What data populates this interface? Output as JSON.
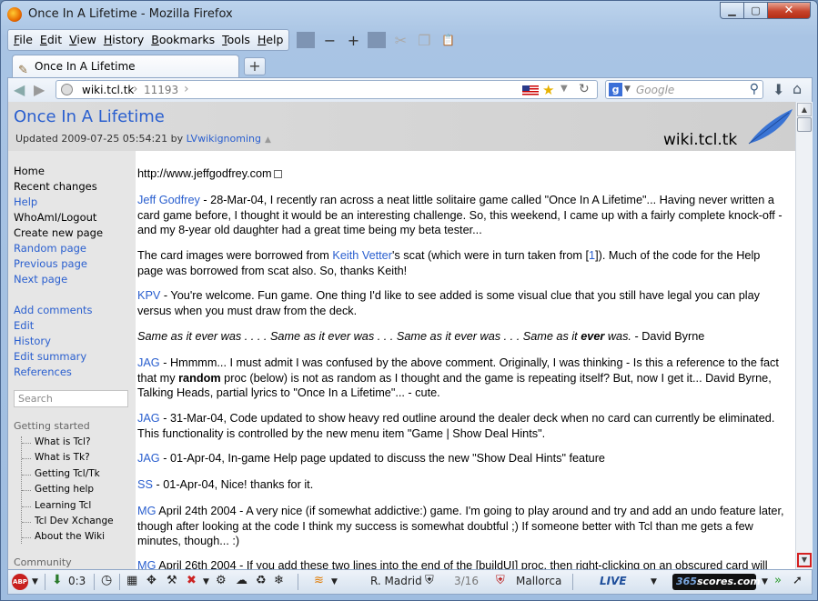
{
  "window": {
    "title": "Once In A Lifetime - Mozilla Firefox",
    "buttons": {
      "minimize": "▁",
      "maximize": "▢",
      "close": "✕"
    }
  },
  "menubar": {
    "items": [
      {
        "label": "File",
        "key": "F",
        "rest": "ile"
      },
      {
        "label": "Edit",
        "key": "E",
        "rest": "dit"
      },
      {
        "label": "View",
        "key": "V",
        "rest": "iew"
      },
      {
        "label": "History",
        "key": "H",
        "rest": "istory"
      },
      {
        "label": "Bookmarks",
        "key": "B",
        "rest": "ookmarks"
      },
      {
        "label": "Tools",
        "key": "T",
        "rest": "ools"
      },
      {
        "label": "Help",
        "key": "H",
        "rest": "elp"
      }
    ],
    "icons": {
      "zoom_out": "−",
      "zoom_in": "+",
      "cut": "✂",
      "copy": "❐",
      "paste": "📋"
    }
  },
  "tabs": {
    "active_tab": "Once In A Lifetime",
    "new_tab": "+"
  },
  "nav": {
    "url_domain": "wiki.tcl.tk",
    "url_path": "11193",
    "search_placeholder": "Google",
    "search_engine_letter": "g"
  },
  "page": {
    "title": "Once In A Lifetime",
    "updated_prefix": "Updated 2009-07-25 05:54:21 by ",
    "updated_author": "LVwikignoming",
    "site_name": "wiki.tcl.tk"
  },
  "sidebar": {
    "nav_links": [
      "Home",
      "Recent changes",
      "Help",
      "WhoAmI/Logout",
      "Create new page",
      "Random page",
      "Previous page",
      "Next page"
    ],
    "page_links": [
      "Add comments",
      "Edit",
      "History",
      "Edit summary",
      "References"
    ],
    "search_placeholder": "Search",
    "getting_started_heading": "Getting started",
    "getting_started_items": [
      "What is Tcl?",
      "What is Tk?",
      "Getting Tcl/Tk",
      "Getting help",
      "Learning Tcl",
      "Tcl Dev Xchange",
      "About the Wiki"
    ],
    "community_heading": "Community"
  },
  "content": {
    "p0_link": "http://www.jeffgodfrey.com",
    "p1_author": "Jeff Godfrey",
    "p1_text": " - 28-Mar-04, I recently ran across a neat little solitaire game called \"Once In A Lifetime\"... Having never written a card game before, I thought it would be an interesting challenge. So, this weekend, I came up with a fairly complete knock-off - and my 8-year old daughter had a great time being my beta tester...",
    "p2_a": "The card images were borrowed from ",
    "p2_link": "Keith Vetter",
    "p2_b": "'s scat (which were in turn taken from [",
    "p2_ref": "1",
    "p2_c": "]). Much of the code for the Help page was borrowed from scat also. So, thanks Keith!",
    "p3_author": "KPV",
    "p3_text": " - You're welcome. Fun game. One thing I'd like to see added is some visual clue that you still have legal you can play versus when you must draw from the deck.",
    "p4_italic": "Same as it ever was . . . . Same as it ever was . . . Same as it ever was . . . Same as it ",
    "p4_bold": "ever",
    "p4_italic2": " was.",
    "p4_tail": " - David Byrne",
    "p5_author": "JAG",
    "p5_a": " - Hmmmm... I must admit I was confused by the above comment. Originally, I was thinking - Is this a reference to the fact that my ",
    "p5_bold": "random",
    "p5_b": " proc (below) is not as random as I thought and the game is repeating itself? But, now I get it... David Byrne, Talking Heads, partial lyrics to \"Once In a Lifetime\"... - cute.",
    "p6_author": "JAG",
    "p6_text": " - 31-Mar-04, Code updated to show heavy red outline around the dealer deck when no card can currently be eliminated. This functionality is controlled by the new menu item \"Game | Show Deal Hints\".",
    "p7_author": "JAG",
    "p7_text": " - 01-Apr-04, In-game Help page updated to discuss the new \"Show Deal Hints\" feature",
    "p8_author": "SS",
    "p8_text": " - 01-Apr-04, Nice! thanks for it.",
    "p9_author": "MG",
    "p9_text": " April 24th 2004 - A very nice (if somewhat addictive:) game. I'm going to play around and try and add an undo feature later, though after looking at the code I think my success is somewhat doubtful ;) If someone better with Tcl than me gets a few minutes, though... :)",
    "p10_author": "MG",
    "p10_text": " April 26th 2004 - If you add these two lines into the end of the [buildUI] proc, then right-clicking on an obscured card will"
  },
  "addonbar": {
    "abp": "ABP",
    "counter": "0:3",
    "team_home": "R. Madrid",
    "match_score": "3/16",
    "team_away": "Mallorca",
    "live": "LIVE",
    "scores_num": "365",
    "scores_text": "scores.com"
  },
  "colors": {
    "link": "#2a5fcf",
    "header_bg": "#d6d6d6",
    "sidebar_bg": "#e6e6e6",
    "close_button": "#c7432b",
    "highlight_box": "#d42020"
  }
}
